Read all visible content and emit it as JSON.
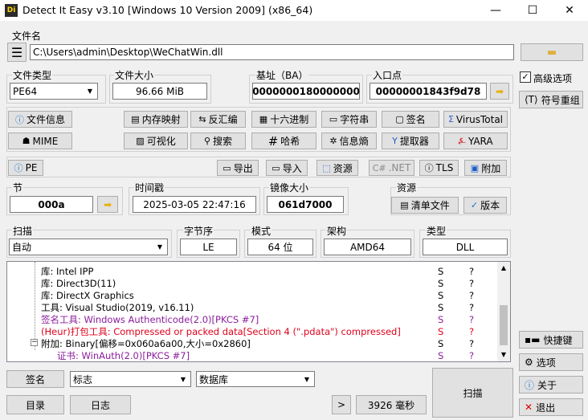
{
  "window": {
    "title": "Detect It Easy v3.10 [Windows 10 Version 2009] (x86_64)",
    "icon_text": "Di"
  },
  "file": {
    "label": "文件名",
    "path": "C:\\Users\\admin\\Desktop\\WeChatWin.dll"
  },
  "filetype": {
    "label": "文件类型",
    "value": "PE64"
  },
  "filesize": {
    "label": "文件大小",
    "value": "96.66 MiB"
  },
  "base": {
    "label": "基址（BA）",
    "value": "0000000180000000"
  },
  "entry": {
    "label": "入口点",
    "value": "00000001843f9d78"
  },
  "toolbar1": {
    "fileinfo": "文件信息",
    "memmap": "内存映射",
    "disasm": "反汇编",
    "hex": "十六进制",
    "strings": "字符串",
    "signatures": "签名",
    "virustotal": "VirusTotal"
  },
  "toolbar2": {
    "mime": "MIME",
    "visualize": "可视化",
    "search": "搜索",
    "hash": "哈希",
    "entropy": "信息熵",
    "extractor": "提取器",
    "yara": "YARA"
  },
  "pebar": {
    "pe": "PE",
    "export": "导出",
    "import": "导入",
    "resources": "资源",
    "net": ".NET",
    "tls": "TLS",
    "overlay": "附加"
  },
  "section": {
    "label": "节",
    "value": "000a"
  },
  "timestamp": {
    "label": "时间戳",
    "value": "2025-03-05 22:47:16"
  },
  "imagesize": {
    "label": "镜像大小",
    "value": "061d7000"
  },
  "resgroup": {
    "label": "资源",
    "manifest": "清单文件",
    "version": "版本"
  },
  "scan": {
    "label": "扫描",
    "mode": "自动"
  },
  "endian": {
    "label": "字节序",
    "value": "LE"
  },
  "mode": {
    "label": "模式",
    "value": "64 位"
  },
  "arch": {
    "label": "架构",
    "value": "AMD64"
  },
  "type": {
    "label": "类型",
    "value": "DLL"
  },
  "results": [
    {
      "text": "库: Intel IPP",
      "s": "S",
      "q": "?",
      "color": "black",
      "indent": 42
    },
    {
      "text": "库: Direct3D(11)",
      "s": "S",
      "q": "?",
      "color": "black",
      "indent": 42
    },
    {
      "text": "库: DirectX Graphics",
      "s": "S",
      "q": "?",
      "color": "black",
      "indent": 42
    },
    {
      "text": "工具: Visual Studio(2019, v16.11)",
      "s": "S",
      "q": "?",
      "color": "black",
      "indent": 42
    },
    {
      "text": "签名工具: Windows Authenticode(2.0)[PKCS #7]",
      "s": "S",
      "q": "?",
      "color": "purple",
      "indent": 42
    },
    {
      "text": "(Heur)打包工具: Compressed or packed data[Section 4 (\".pdata\") compressed]",
      "s": "S",
      "q": "?",
      "color": "red",
      "indent": 42
    },
    {
      "text": "附加: Binary[偏移=0x060a6a00,大小=0x2860]",
      "s": "S",
      "q": "?",
      "color": "black",
      "indent": 42
    },
    {
      "text": "证书: WinAuth(2.0)[PKCS #7]",
      "s": "S",
      "q": "?",
      "color": "purple",
      "indent": 62
    }
  ],
  "bottom": {
    "signatures": "签名",
    "flags": "标志",
    "database": "数据库",
    "dir": "目录",
    "log": "日志",
    "more": ">",
    "time": "3926 毫秒",
    "scan": "扫描"
  },
  "sidebar": {
    "advanced": "高级选项",
    "reorder": "符号重组",
    "shortcuts": "快捷键",
    "options": "选项",
    "about": "关于",
    "exit": "退出"
  },
  "colors": {
    "purple": "#8b1d9c",
    "red": "#e0001b"
  }
}
